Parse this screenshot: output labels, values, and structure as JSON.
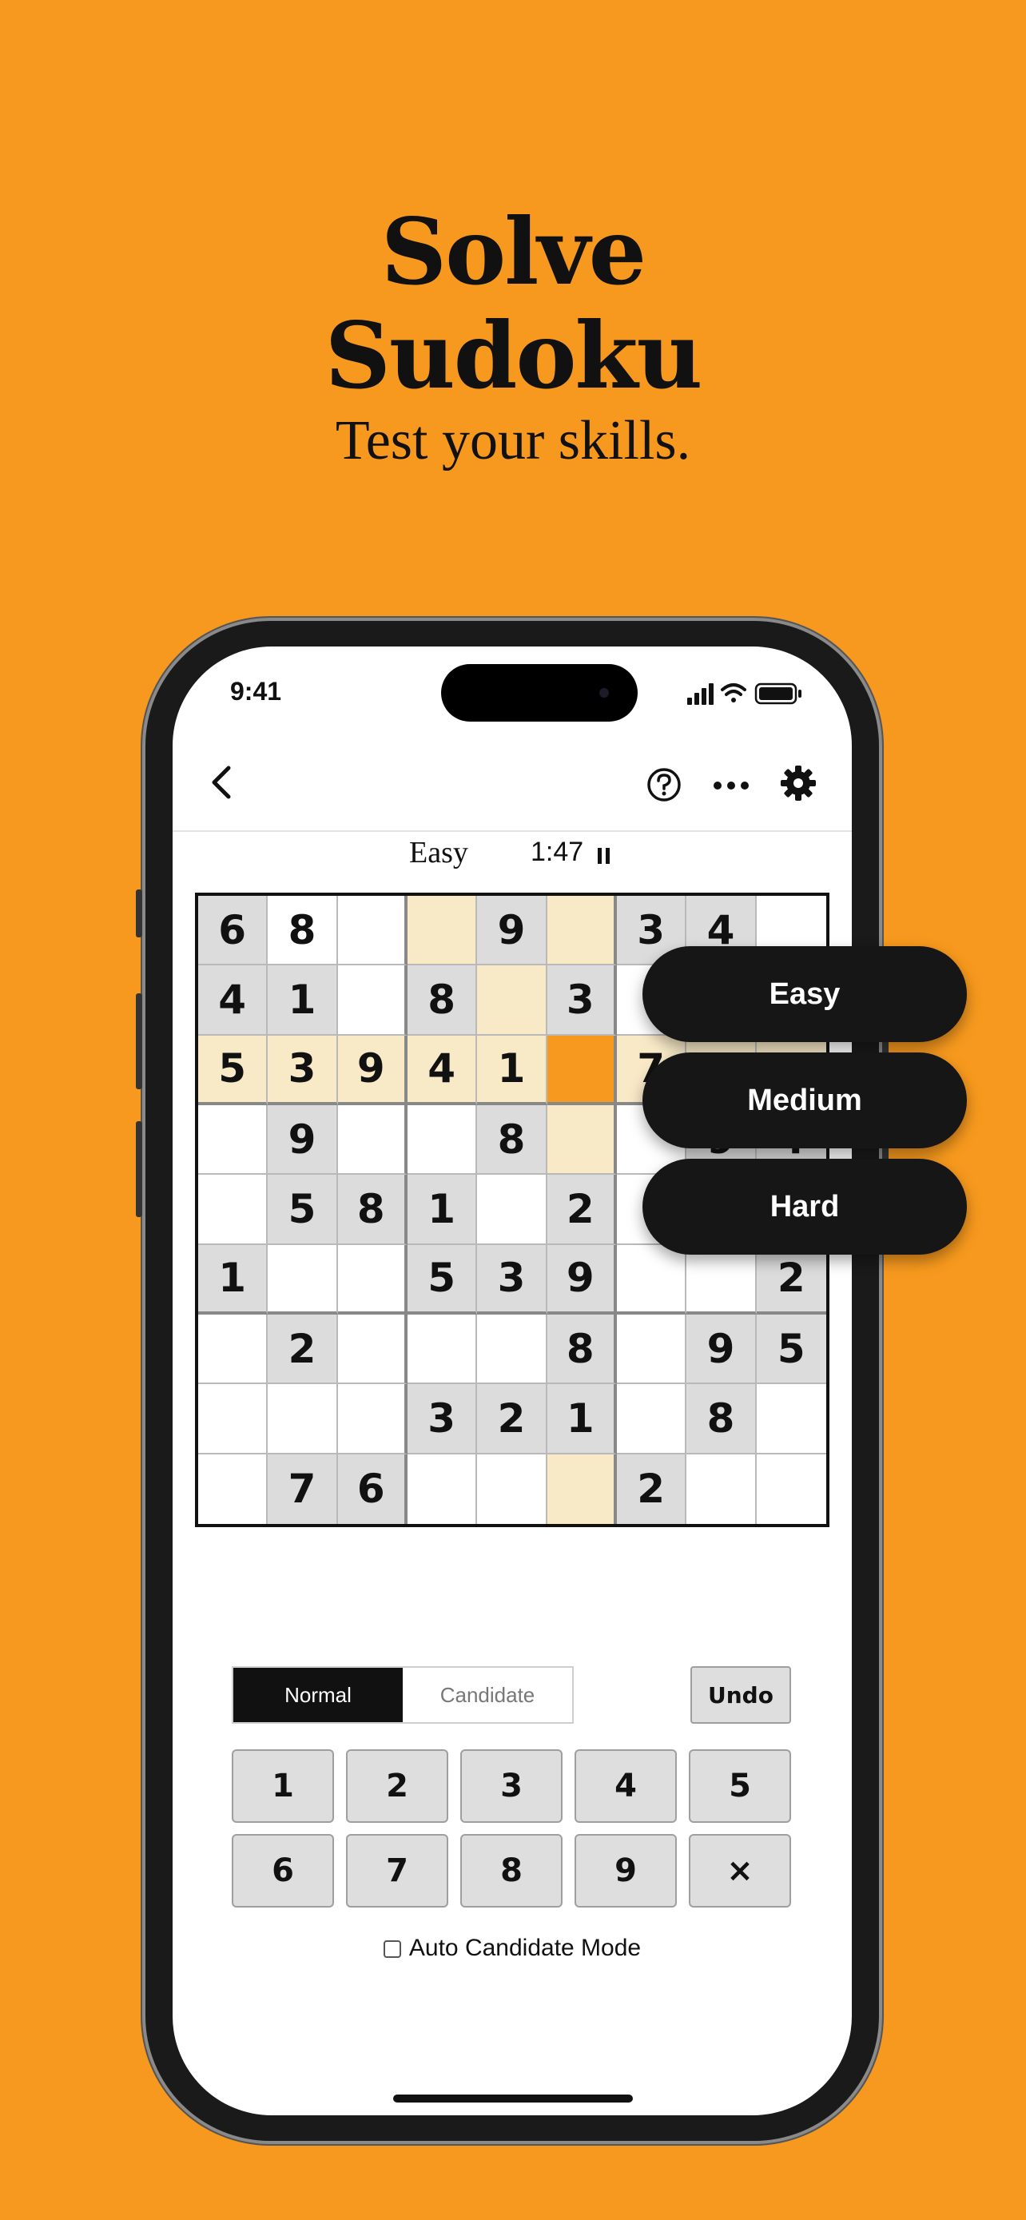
{
  "promo": {
    "headline_line1": "Solve",
    "headline_line2": "Sudoku",
    "tagline": "Test your skills."
  },
  "status_bar": {
    "time": "9:41"
  },
  "toolbar": {
    "icons": [
      "back-chevron-icon",
      "help-icon",
      "more-icon",
      "settings-icon"
    ]
  },
  "game": {
    "level": "Easy",
    "timer": "1:47"
  },
  "board": {
    "rows": [
      [
        "6",
        "8",
        "",
        "",
        "9",
        "",
        "3",
        "4",
        ""
      ],
      [
        "4",
        "1",
        "",
        "8",
        "",
        "3",
        "",
        "",
        ""
      ],
      [
        "5",
        "3",
        "9",
        "4",
        "1",
        "",
        "7",
        "",
        ""
      ],
      [
        "",
        "9",
        "",
        "",
        "8",
        "",
        "",
        "9",
        "4"
      ],
      [
        "",
        "5",
        "8",
        "1",
        "",
        "2",
        "",
        "",
        ""
      ],
      [
        "1",
        "",
        "",
        "5",
        "3",
        "9",
        "",
        "",
        "2"
      ],
      [
        "",
        "2",
        "",
        "",
        "",
        "8",
        "",
        "9",
        "5"
      ],
      [
        "",
        "",
        "",
        "3",
        "2",
        "1",
        "",
        "8",
        ""
      ],
      [
        "",
        "7",
        "6",
        "",
        "",
        "",
        "2",
        "",
        ""
      ]
    ],
    "given": [
      [
        1,
        0,
        0,
        0,
        1,
        0,
        1,
        1,
        0
      ],
      [
        1,
        1,
        0,
        1,
        0,
        1,
        0,
        0,
        0
      ],
      [
        0,
        0,
        0,
        0,
        0,
        0,
        0,
        0,
        0
      ],
      [
        0,
        1,
        0,
        0,
        1,
        0,
        0,
        1,
        1
      ],
      [
        0,
        1,
        1,
        1,
        0,
        1,
        0,
        0,
        0
      ],
      [
        1,
        0,
        0,
        1,
        1,
        1,
        0,
        0,
        1
      ],
      [
        0,
        1,
        0,
        0,
        0,
        1,
        0,
        1,
        1
      ],
      [
        0,
        0,
        0,
        1,
        1,
        1,
        0,
        1,
        0
      ],
      [
        0,
        1,
        1,
        0,
        0,
        0,
        1,
        0,
        0
      ]
    ],
    "selected_cell": {
      "row": 3,
      "col": 6
    },
    "colors": {
      "given": "#dcdcdc",
      "highlight": "#f8e9c7",
      "selected": "#F7991E"
    }
  },
  "input_mode": {
    "normal_label": "Normal",
    "candidate_label": "Candidate",
    "active": "Normal"
  },
  "undo_label": "Undo",
  "keypad": [
    "1",
    "2",
    "3",
    "4",
    "5",
    "6",
    "7",
    "8",
    "9",
    "×"
  ],
  "auto_candidate_label": "Auto Candidate Mode",
  "difficulty_menu": [
    "Easy",
    "Medium",
    "Hard"
  ],
  "theme": {
    "background": "#F7991E",
    "ink": "#111111"
  }
}
